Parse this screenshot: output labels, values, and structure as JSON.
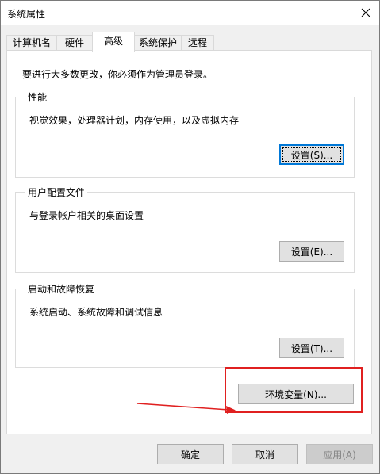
{
  "window": {
    "title": "系统属性"
  },
  "tabs": [
    {
      "label": "计算机名"
    },
    {
      "label": "硬件"
    },
    {
      "label": "高级"
    },
    {
      "label": "系统保护"
    },
    {
      "label": "远程"
    }
  ],
  "active_tab": "高级",
  "intro_text": "要进行大多数更改，你必须作为管理员登录。",
  "groups": {
    "performance": {
      "title": "性能",
      "desc": "视觉效果，处理器计划，内存使用，以及虚拟内存",
      "button": "设置(S)..."
    },
    "user_profiles": {
      "title": "用户配置文件",
      "desc": "与登录帐户相关的桌面设置",
      "button": "设置(E)..."
    },
    "startup_recovery": {
      "title": "启动和故障恢复",
      "desc": "系统启动、系统故障和调试信息",
      "button": "设置(T)..."
    }
  },
  "env_button": "环境变量(N)...",
  "footer": {
    "ok": "确定",
    "cancel": "取消",
    "apply": "应用(A)"
  },
  "annotation_color": "#e02020"
}
